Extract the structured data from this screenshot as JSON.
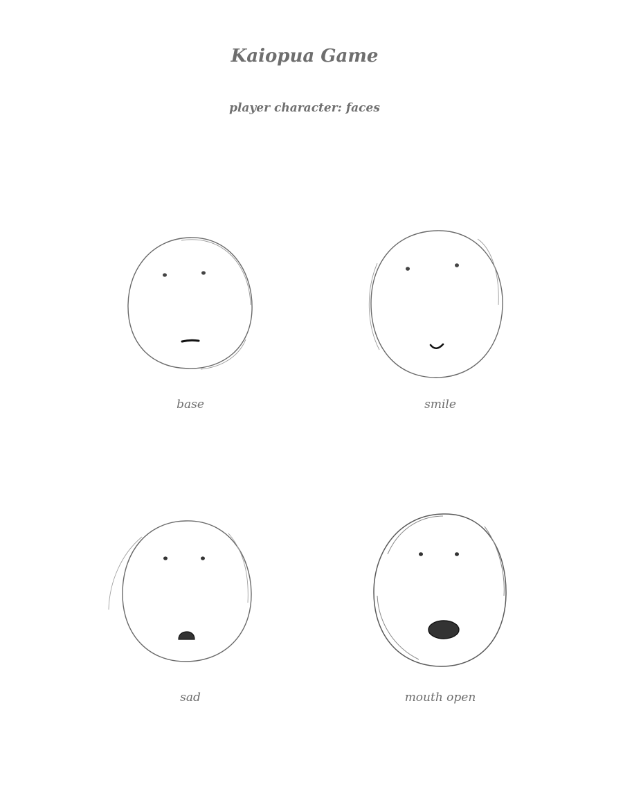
{
  "page": {
    "title": "Kaiopua Game",
    "subtitle": "player character: faces"
  },
  "faces": [
    {
      "label": "base"
    },
    {
      "label": "smile"
    },
    {
      "label": "sad"
    },
    {
      "label": "mouth open"
    }
  ],
  "colors": {
    "ink": "#2a2a2a",
    "text": "#6e6e6e",
    "background": "#ffffff"
  }
}
